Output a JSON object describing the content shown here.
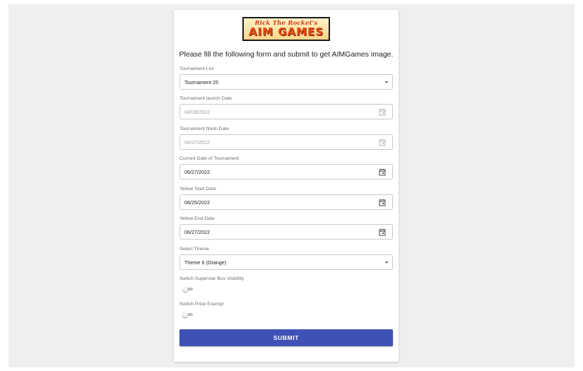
{
  "logo": {
    "line1": "Rick The Rocket's",
    "line2": "AIM GAMES"
  },
  "intro": "Please fill the following form and submit to get AIMGames image.",
  "fields": [
    {
      "label": "Tournament List",
      "value": "Tournament 25",
      "type": "select",
      "disabled": false
    },
    {
      "label": "Tournament launch Date",
      "value": "04/08/2022",
      "type": "date",
      "disabled": true
    },
    {
      "label": "Tournament finish Date",
      "value": "06/27/2022",
      "type": "date",
      "disabled": true
    },
    {
      "label": "Current Date of Tournament",
      "value": "06/27/2022",
      "type": "date",
      "disabled": false
    },
    {
      "label": "Yellow Start Date",
      "value": "06/25/2022",
      "type": "date",
      "disabled": false
    },
    {
      "label": "Yellow End Date",
      "value": "06/27/2022",
      "type": "date",
      "disabled": false
    },
    {
      "label": "Select Theme",
      "value": "Theme 6 (Orange)",
      "type": "select",
      "disabled": false
    }
  ],
  "switches": [
    {
      "label": "Switch Superstar Box Visibility",
      "on": false
    },
    {
      "label": "Switch Prize Exempt",
      "on": false
    }
  ],
  "submit_label": "SUBMIT",
  "colors": {
    "accent": "#3f51b5",
    "background": "#efefef"
  }
}
